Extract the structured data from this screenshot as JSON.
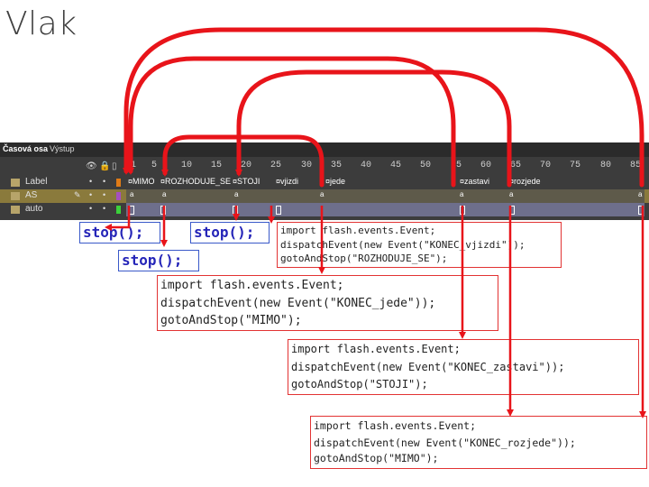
{
  "slide_title": "Vlak",
  "timeline": {
    "tabs": [
      "Časová osa",
      "Výstup"
    ],
    "ruler": [
      "1",
      "5",
      "10",
      "15",
      "20",
      "25",
      "30",
      "35",
      "40",
      "45",
      "50",
      "55",
      "60",
      "65",
      "70",
      "75",
      "80",
      "85"
    ],
    "layers": [
      {
        "name": "Label",
        "color": "#e07b16"
      },
      {
        "name": "AS",
        "color": "#a54fc0"
      },
      {
        "name": "auto",
        "color": "#3bd13b"
      }
    ],
    "frame_labels": [
      "MIMO",
      "ROZHODUJE_SE",
      "STOJI",
      "vjizdi",
      "jede",
      "zastavi",
      "rozjede"
    ],
    "as_marker": "a"
  },
  "code": {
    "stop_1": "stop();",
    "stop_2": "stop();",
    "stop_3": "stop();",
    "box_vjizdi": [
      "import flash.events.Event;",
      "dispatchEvent(new Event(\"KONEC_vjizdi\"));",
      "gotoAndStop(\"ROZHODUJE_SE\");"
    ],
    "box_jede": [
      "import flash.events.Event;",
      "dispatchEvent(new Event(\"KONEC_jede\"));",
      "gotoAndStop(\"MIMO\");"
    ],
    "box_zastavi": [
      "import flash.events.Event;",
      "dispatchEvent(new Event(\"KONEC_zastavi\"));",
      "gotoAndStop(\"STOJI\");"
    ],
    "box_rozjede": [
      "import flash.events.Event;",
      "dispatchEvent(new Event(\"KONEC_rozjede\"));",
      "gotoAndStop(\"MIMO\");"
    ]
  },
  "colors": {
    "arrow": "#e8141a",
    "box_border": "#e23333",
    "timeline_bg": "#3c3c3c"
  }
}
